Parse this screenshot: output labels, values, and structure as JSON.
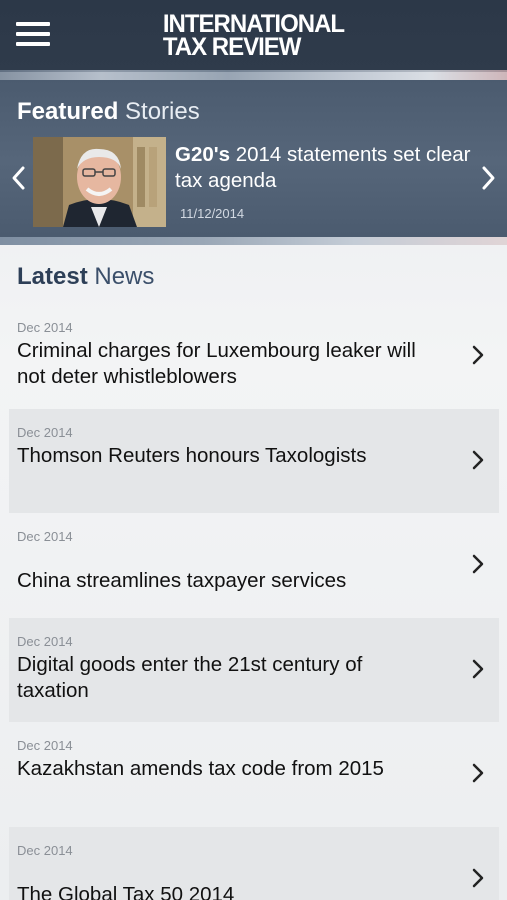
{
  "header": {
    "logo_line1": "INTERNATIONAL",
    "logo_line2": "TAX REVIEW",
    "menu_icon": "hamburger-menu-icon"
  },
  "featured": {
    "title_strong": "Featured",
    "title_light": "Stories",
    "headline_bold": "G20's",
    "headline_rest": " 2014 statements set clear tax agenda",
    "date": "11/12/2014",
    "prev_icon": "chevron-left-icon",
    "next_icon": "chevron-right-icon"
  },
  "latest": {
    "title_strong": "Latest",
    "title_light": "News",
    "items": [
      {
        "date": "Dec 2014",
        "headline": "Criminal charges for Luxembourg leaker will not deter whistleblowers"
      },
      {
        "date": "Dec 2014",
        "headline": "Thomson Reuters honours Taxologists"
      },
      {
        "date": "Dec 2014",
        "headline": "China streamlines taxpayer services"
      },
      {
        "date": "Dec 2014",
        "headline": "Digital goods enter the 21st century of taxation"
      },
      {
        "date": "Dec 2014",
        "headline": "Kazakhstan amends tax code from 2015"
      },
      {
        "date": "Dec 2014",
        "headline": "The Global Tax 50 2014"
      }
    ]
  },
  "colors": {
    "header_bg": "#2f3b4b",
    "featured_bg": "#56667a",
    "shaded_row": "#e4e6e8",
    "latest_title": "#2d3f57"
  }
}
